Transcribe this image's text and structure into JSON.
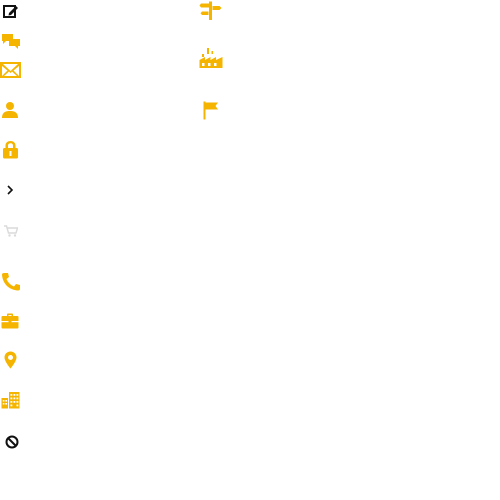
{
  "colors": {
    "primary": "#F4B400",
    "dark": "#111111",
    "faint": "#DADADA",
    "background": "#FFFFFF"
  },
  "icons": {
    "column_left": [
      "edit-icon",
      "chat-bubbles-icon",
      "mail-icon",
      "user-icon",
      "lock-icon",
      "chevron-right-icon",
      "cart-icon",
      "phone-icon",
      "briefcase-icon",
      "map-pin-icon",
      "buildings-icon",
      "block-icon"
    ],
    "column_right": [
      "signpost-icon",
      "factory-icon",
      "flag-icon"
    ]
  }
}
